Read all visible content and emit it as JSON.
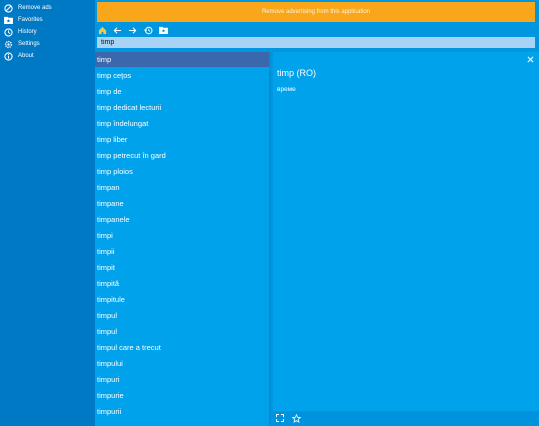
{
  "sidebar": {
    "items": [
      {
        "label": "Remove ads",
        "icon": "block-icon"
      },
      {
        "label": "Favorites",
        "icon": "folder-star-icon"
      },
      {
        "label": "History",
        "icon": "history-icon"
      },
      {
        "label": "Settings",
        "icon": "gear-icon"
      },
      {
        "label": "About",
        "icon": "info-icon"
      }
    ]
  },
  "banner": {
    "text": "Remove advertising from this application"
  },
  "toolbar": {
    "buttons": [
      "home-icon",
      "back-arrow-icon",
      "forward-arrow-icon",
      "history-icon",
      "folder-star-icon"
    ]
  },
  "search": {
    "value": "timp"
  },
  "results": {
    "items": [
      "timp",
      "timp ceţos",
      "timp de",
      "timp dedicat lecturii",
      "timp îndelungat",
      "timp liber",
      "timp petrecut în gard",
      "timp ploios",
      "timpan",
      "timpane",
      "timpanele",
      "timpi",
      "timpii",
      "timpit",
      "timpită",
      "timpitule",
      "timpul",
      "timpul",
      "timpul care a trecut",
      "timpului",
      "timpuri",
      "timpurie",
      "timpurii"
    ],
    "selected_index": 0
  },
  "detail": {
    "title": "timp (RO)",
    "translation": "време"
  },
  "colors": {
    "sidebar": "#0079c4",
    "list": "#00a2ec",
    "selected": "#3b67ad",
    "banner": "#f9a61a",
    "search": "#a9d3f5"
  }
}
